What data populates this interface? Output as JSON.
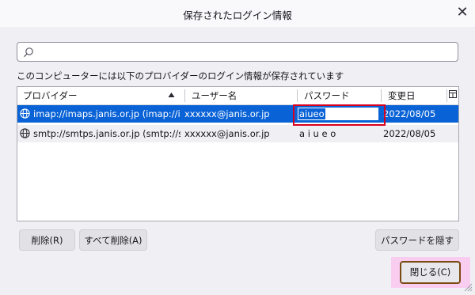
{
  "dialog": {
    "title": "保存されたログイン情報",
    "close_glyph": "✕"
  },
  "search": {
    "placeholder": "",
    "value": "",
    "icon": "search-icon"
  },
  "description": "このコンピューターには以下のプロバイダーのログイン情報が保存されています",
  "table": {
    "columns": [
      "プロバイダー",
      "ユーザー名",
      "パスワード",
      "変更日"
    ],
    "sort_column": "プロバイダー",
    "sort_direction": "ascending",
    "rows": [
      {
        "provider": "imap://imaps.janis.or.jp (imap://ima...",
        "username": "xxxxxx@janis.or.jp",
        "password": "aiueo",
        "changed": "2022/08/05",
        "selected": true,
        "editing_password": true
      },
      {
        "provider": "smtp://smtps.janis.or.jp (smtp://smt...",
        "username": "xxxxxx@janis.or.jp",
        "password": "a i u e o",
        "changed": "2022/08/05",
        "selected": false,
        "editing_password": false
      }
    ]
  },
  "buttons": {
    "delete": "削除(R)",
    "delete_all": "すべて削除(A)",
    "hide_passwords": "パスワードを隠す(P)",
    "close": "閉じる(C)"
  },
  "colors": {
    "selection": "#0a63d6",
    "highlight_box": "#d8001e",
    "close_highlight_bg": "#f9cdf0",
    "close_border": "#7a4a12"
  }
}
